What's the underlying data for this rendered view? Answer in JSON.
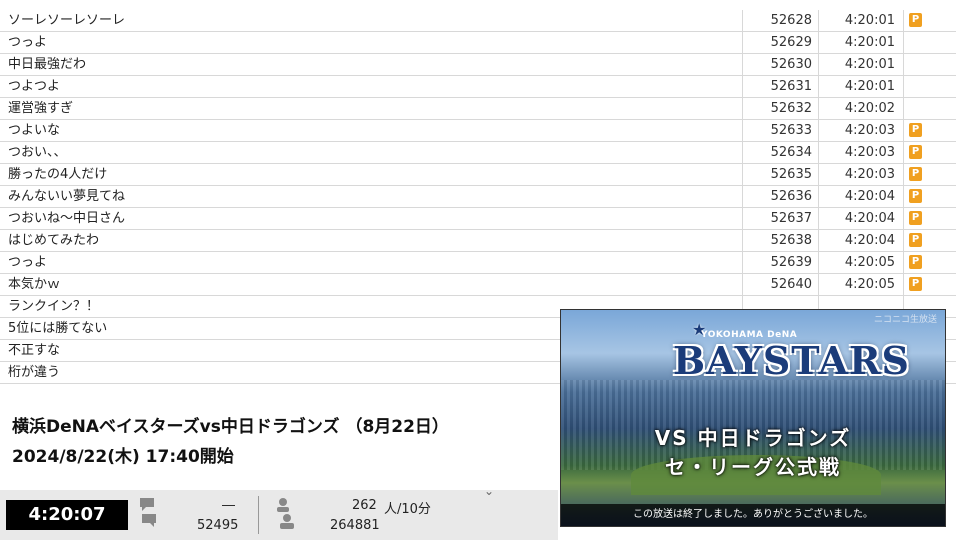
{
  "comments": [
    {
      "text": "ソーレソーレソーレ",
      "no": "52628",
      "time": "4:20:01",
      "premium": true
    },
    {
      "text": "つっよ",
      "no": "52629",
      "time": "4:20:01",
      "premium": false
    },
    {
      "text": "中日最強だわ",
      "no": "52630",
      "time": "4:20:01",
      "premium": false
    },
    {
      "text": "つよつよ",
      "no": "52631",
      "time": "4:20:01",
      "premium": false
    },
    {
      "text": "運営強すぎ",
      "no": "52632",
      "time": "4:20:02",
      "premium": false
    },
    {
      "text": "つよいな",
      "no": "52633",
      "time": "4:20:03",
      "premium": true
    },
    {
      "text": "つおい、、",
      "no": "52634",
      "time": "4:20:03",
      "premium": true
    },
    {
      "text": "勝ったの4人だけ",
      "no": "52635",
      "time": "4:20:03",
      "premium": true
    },
    {
      "text": "みんないい夢見てね",
      "no": "52636",
      "time": "4:20:04",
      "premium": true
    },
    {
      "text": "つおいね～中日さん",
      "no": "52637",
      "time": "4:20:04",
      "premium": true
    },
    {
      "text": "はじめてみたわ",
      "no": "52638",
      "time": "4:20:04",
      "premium": true
    },
    {
      "text": "つっよ",
      "no": "52639",
      "time": "4:20:05",
      "premium": true
    },
    {
      "text": "本気かｗ",
      "no": "52640",
      "time": "4:20:05",
      "premium": true
    },
    {
      "text": "ランクイン？！",
      "no": "",
      "time": "",
      "premium": false
    },
    {
      "text": "5位には勝てない",
      "no": "",
      "time": "",
      "premium": false
    },
    {
      "text": "不正すな",
      "no": "",
      "time": "",
      "premium": false
    },
    {
      "text": "桁が違う",
      "no": "",
      "time": "",
      "premium": false
    }
  ],
  "premium_badge_label": "P",
  "program": {
    "title": "横浜DeNAベイスターズvs中日ドラゴンズ （8月22日）",
    "start": "2024/8/22(木) 17:40開始"
  },
  "status": {
    "elapsed": "4:20:07",
    "comment_rate": "―",
    "comment_total": "52495",
    "viewer_rate": "262",
    "viewer_rate_unit": "人/10分",
    "viewer_total": "264881",
    "collapse_glyph": "⌄"
  },
  "player": {
    "watermark": "ニコニコ生放送",
    "logo_small": "YOKOHAMA DeNA",
    "logo_big": "BAYSTARS",
    "vs_text": "VS 中日ドラゴンズ",
    "league_text": "セ・リーグ公式戦",
    "end_message": "この放送は終了しました。ありがとうございました。"
  },
  "colors": {
    "premium_badge": "#f0a020",
    "timer_bg": "#000000",
    "brand_blue": "#1b3c7a"
  },
  "icons": {
    "comment": "speech-bubble-icon",
    "viewer": "person-icon"
  }
}
